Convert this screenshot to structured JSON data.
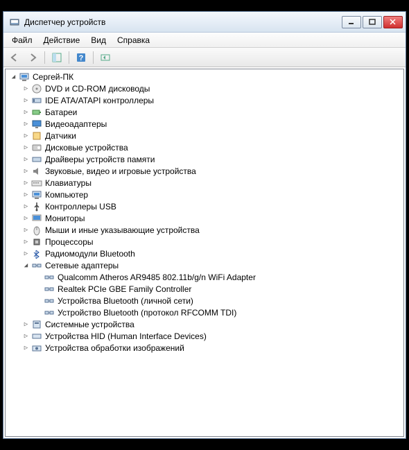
{
  "window": {
    "title": "Диспетчер устройств"
  },
  "menubar": {
    "file": "Файл",
    "action": "Действие",
    "view": "Вид",
    "help": "Справка"
  },
  "tree": {
    "root": {
      "label": "Сергей-ПК",
      "expanded": true
    },
    "categories": [
      {
        "label": "DVD и CD-ROM дисководы",
        "icon": "disc",
        "expanded": false
      },
      {
        "label": "IDE ATA/ATAPI контроллеры",
        "icon": "ide",
        "expanded": false
      },
      {
        "label": "Батареи",
        "icon": "battery",
        "expanded": false
      },
      {
        "label": "Видеоадаптеры",
        "icon": "display",
        "expanded": false
      },
      {
        "label": "Датчики",
        "icon": "sensor",
        "expanded": false
      },
      {
        "label": "Дисковые устройства",
        "icon": "disk",
        "expanded": false
      },
      {
        "label": "Драйверы устройств памяти",
        "icon": "memory",
        "expanded": false
      },
      {
        "label": "Звуковые, видео и игровые устройства",
        "icon": "sound",
        "expanded": false
      },
      {
        "label": "Клавиатуры",
        "icon": "keyboard",
        "expanded": false
      },
      {
        "label": "Компьютер",
        "icon": "computer",
        "expanded": false
      },
      {
        "label": "Контроллеры USB",
        "icon": "usb",
        "expanded": false
      },
      {
        "label": "Мониторы",
        "icon": "monitor",
        "expanded": false
      },
      {
        "label": "Мыши и иные указывающие устройства",
        "icon": "mouse",
        "expanded": false
      },
      {
        "label": "Процессоры",
        "icon": "cpu",
        "expanded": false
      },
      {
        "label": "Радиомодули Bluetooth",
        "icon": "bluetooth",
        "expanded": false
      },
      {
        "label": "Сетевые адаптеры",
        "icon": "network",
        "expanded": true,
        "children": [
          {
            "label": "Qualcomm Atheros AR9485 802.11b/g/n WiFi Adapter"
          },
          {
            "label": "Realtek PCIe GBE Family Controller"
          },
          {
            "label": "Устройства Bluetooth (личной сети)"
          },
          {
            "label": "Устройство Bluetooth (протокол RFCOMM TDI)"
          }
        ]
      },
      {
        "label": "Системные устройства",
        "icon": "system",
        "expanded": false
      },
      {
        "label": "Устройства HID (Human Interface Devices)",
        "icon": "hid",
        "expanded": false
      },
      {
        "label": "Устройства обработки изображений",
        "icon": "imaging",
        "expanded": false
      }
    ]
  }
}
